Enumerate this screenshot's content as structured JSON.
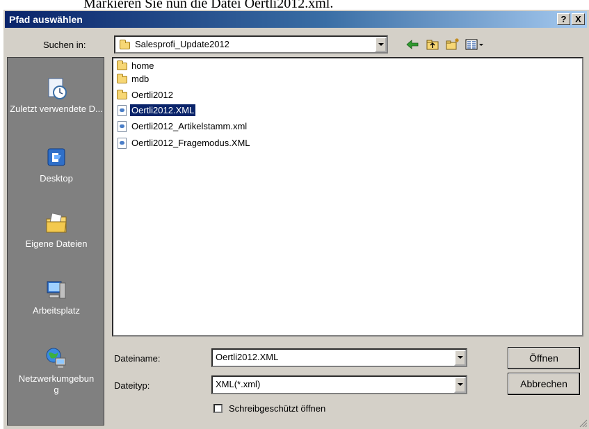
{
  "background_text": "Markieren Sie nun die Datei Oertli2012.xml.",
  "dialog": {
    "title": "Pfad auswählen",
    "help_button": "?",
    "close_button": "X"
  },
  "lookin": {
    "label": "Suchen in:",
    "value": "Salesprofi_Update2012"
  },
  "places": [
    {
      "label": "Zuletzt verwendete D...",
      "icon": "recent-documents-icon"
    },
    {
      "label": "Desktop",
      "icon": "desktop-icon"
    },
    {
      "label": "Eigene Dateien",
      "icon": "my-documents-icon"
    },
    {
      "label": "Arbeitsplatz",
      "icon": "my-computer-icon"
    },
    {
      "label": "Netzwerkumgebung",
      "icon": "network-icon"
    }
  ],
  "files": [
    {
      "name": "home",
      "type": "folder"
    },
    {
      "name": "mdb",
      "type": "folder"
    },
    {
      "name": "Oertli2012",
      "type": "folder"
    },
    {
      "name": "Oertli2012.XML",
      "type": "xml",
      "selected": true
    },
    {
      "name": "Oertli2012_Artikelstamm.xml",
      "type": "xml"
    },
    {
      "name": "Oertli2012_Fragemodus.XML",
      "type": "xml"
    }
  ],
  "filename": {
    "label": "Dateiname:",
    "value": "Oertli2012.XML"
  },
  "filetype": {
    "label": "Dateityp:",
    "value": "XML(*.xml)"
  },
  "readonly_label": "Schreibgeschützt öffnen",
  "open_button": "Öffnen",
  "cancel_button": "Abbrechen",
  "colors": {
    "title_start": "#0a246a",
    "title_end": "#a6caf0",
    "face": "#d4d0c8",
    "places_bar": "#808080",
    "selection": "#0a246a"
  }
}
